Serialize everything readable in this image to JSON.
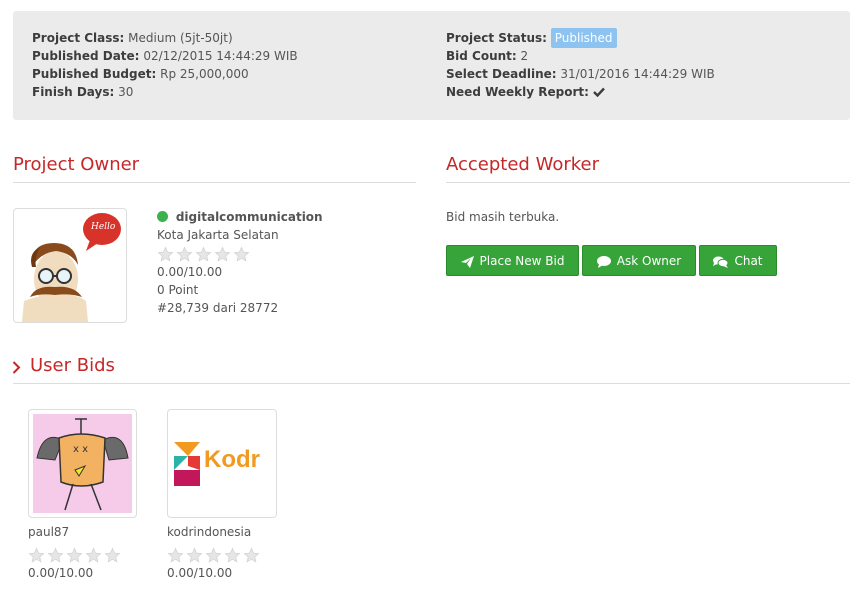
{
  "project_info": {
    "class_label": "Project Class:",
    "class_value": "Medium (5jt-50jt)",
    "published_date_label": "Published Date:",
    "published_date_value": "02/12/2015 14:44:29 WIB",
    "budget_label": "Published Budget:",
    "budget_value": "Rp 25,000,000",
    "finish_days_label": "Finish Days:",
    "finish_days_value": "30",
    "status_label": "Project Status:",
    "status_value": "Published",
    "bid_count_label": "Bid Count:",
    "bid_count_value": "2",
    "deadline_label": "Select Deadline:",
    "deadline_value": "31/01/2016 14:44:29 WIB",
    "weekly_report_label": "Need Weekly Report:",
    "weekly_report_icon": "check-icon"
  },
  "owner": {
    "section_title": "Project Owner",
    "avatar_speech": "Hello",
    "username": "digitalcommunication",
    "location": "Kota Jakarta Selatan",
    "rating": "0.00/10.00",
    "points": "0 Point",
    "rank": "#28,739 dari 28772",
    "online_color": "#3bb24b"
  },
  "worker": {
    "section_title": "Accepted Worker",
    "status_text": "Bid masih terbuka.",
    "buttons": {
      "place_bid": "Place New Bid",
      "ask_owner": "Ask Owner",
      "chat": "Chat"
    },
    "button_color": "#37a43a"
  },
  "user_bids": {
    "section_title": "User Bids",
    "bids": [
      {
        "username": "paul87",
        "rating": "0.00/10.00"
      },
      {
        "username": "kodrindonesia",
        "rating": "0.00/10.00",
        "logo_text": "Kodr"
      }
    ]
  },
  "colors": {
    "accent": "#c62828",
    "badge": "#8cc3f0"
  }
}
